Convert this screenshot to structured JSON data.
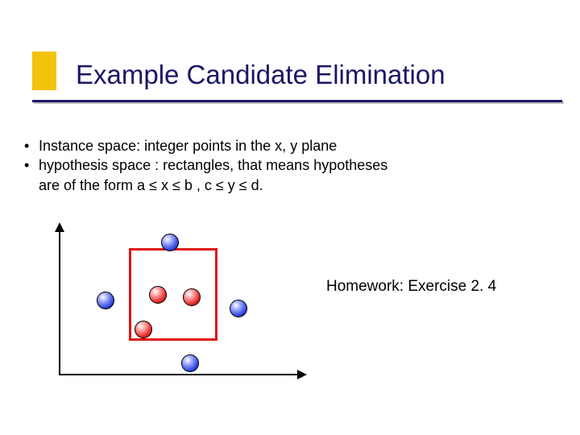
{
  "title": "Example Candidate Elimination",
  "bullets": {
    "b1": "Instance space: integer points in the x, y plane",
    "b2": "hypothesis space : rectangles, that means hypotheses",
    "b2_cont": "are of the form a ≤ x ≤ b , c ≤ y ≤ d."
  },
  "homework": "Homework: Exercise 2. 4",
  "chart_data": {
    "type": "scatter",
    "title": "",
    "xlabel": "",
    "ylabel": "",
    "axes": {
      "x_arrow": true,
      "y_arrow": true,
      "origin": [
        0,
        0
      ]
    },
    "hypothesis_rect": {
      "x": 105,
      "y": 28,
      "w": 110,
      "h": 115
    },
    "points": [
      {
        "x": 145,
        "y": 10,
        "class": "neg",
        "color": "blue"
      },
      {
        "x": 65,
        "y": 82,
        "class": "neg",
        "color": "blue"
      },
      {
        "x": 130,
        "y": 75,
        "class": "pos",
        "color": "red"
      },
      {
        "x": 172,
        "y": 78,
        "class": "pos",
        "color": "red"
      },
      {
        "x": 112,
        "y": 118,
        "class": "pos",
        "color": "red"
      },
      {
        "x": 230,
        "y": 92,
        "class": "neg",
        "color": "blue"
      },
      {
        "x": 170,
        "y": 160,
        "class": "neg",
        "color": "blue"
      }
    ],
    "xlim": [
      0,
      300
    ],
    "ylim": [
      0,
      190
    ]
  }
}
